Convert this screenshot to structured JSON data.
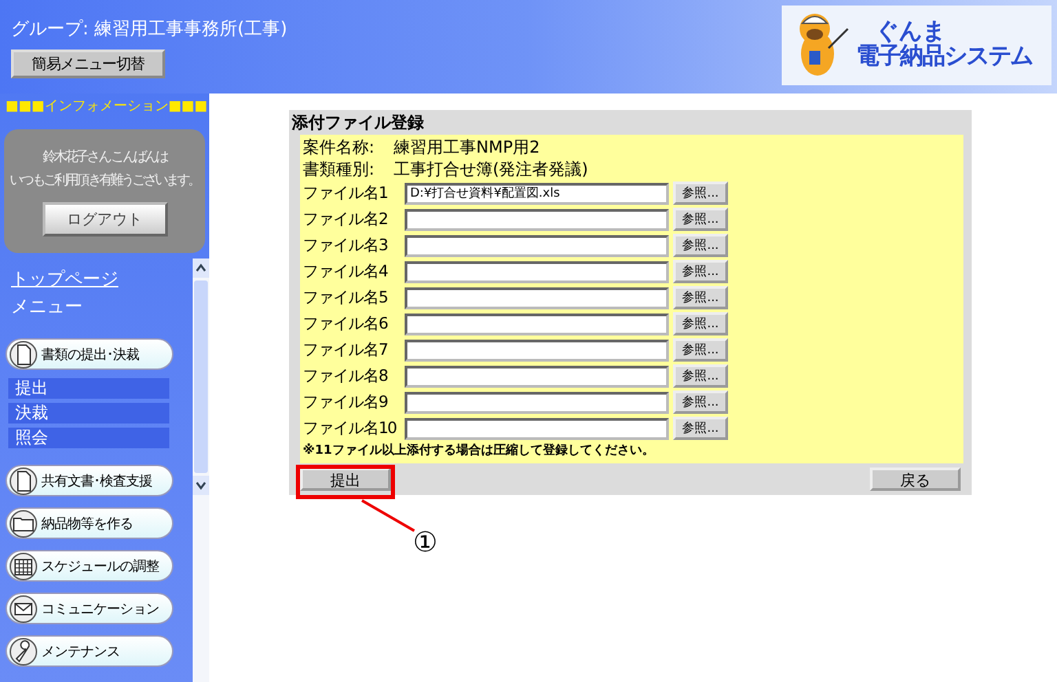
{
  "header": {
    "group_title": "グループ: 練習用工事事務所(工事)",
    "mode_button": "簡易メニュー切替",
    "logo": {
      "line_1": "ぐんま",
      "line_2": "電子納品システム"
    }
  },
  "sidebar": {
    "info_heading": "■■■インフォメーション■■■",
    "greeting_1": "鈴木花子さん こんばんは",
    "greeting_2": "いつもご利用頂き有難うございます。",
    "logout_button": "ログアウト",
    "top_link": "トップページ",
    "menu_heading": "メニュー",
    "menu": [
      {
        "label": "書類の提出･決裁",
        "children": [
          {
            "label": "提出"
          },
          {
            "label": "決裁"
          },
          {
            "label": "照会"
          }
        ]
      },
      {
        "label": "共有文書･検査支援"
      },
      {
        "label": "納品物等を作る"
      },
      {
        "label": "スケジュールの調整"
      },
      {
        "label": "コミュニケーション"
      },
      {
        "label": "メンテナンス"
      }
    ]
  },
  "form": {
    "title": "添付ファイル登録",
    "info": [
      {
        "label": "案件名称:",
        "value": "練習用工事NMP用2"
      },
      {
        "label": "書類種別:",
        "value": "工事打合せ簿(発注者発議)"
      }
    ],
    "files": [
      {
        "label": "ファイル名1",
        "value": "D:¥打合せ資料¥配置図.xls",
        "browse": "参照..."
      },
      {
        "label": "ファイル名2",
        "browse": "参照..."
      },
      {
        "label": "ファイル名3",
        "browse": "参照..."
      },
      {
        "label": "ファイル名4",
        "browse": "参照..."
      },
      {
        "label": "ファイル名5",
        "browse": "参照..."
      },
      {
        "label": "ファイル名6",
        "browse": "参照..."
      },
      {
        "label": "ファイル名7",
        "browse": "参照..."
      },
      {
        "label": "ファイル名8",
        "browse": "参照..."
      },
      {
        "label": "ファイル名9",
        "browse": "参照..."
      },
      {
        "label": "ファイル名10",
        "browse": "参照..."
      }
    ],
    "note": "※11ファイル以上添付する場合は圧縮して登録してください。",
    "submit_button": "提出",
    "back_button": "戻る"
  },
  "annotation": {
    "marker": "①"
  }
}
